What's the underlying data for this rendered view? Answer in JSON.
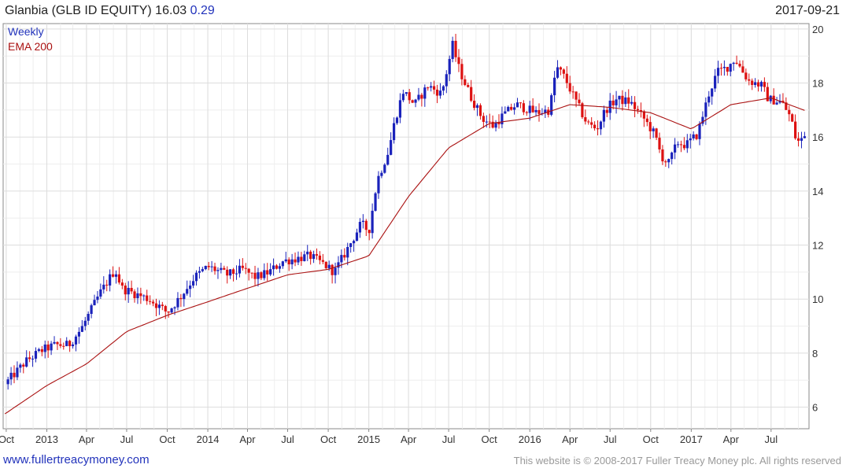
{
  "header": {
    "title": "Glanbia (GLB ID EQUITY) 16.03",
    "change": "0.29",
    "date": "2017-09-21"
  },
  "footer": {
    "site_link": "www.fullertreacymoney.com",
    "copyright": "This website is © 2008-2017 Fuller Treacy Money plc. All rights reserved"
  },
  "colors": {
    "up": "#1a22bb",
    "down": "#dd1111",
    "ema": "#aa1111",
    "grid": "#dddddd",
    "legend_weekly": "#2233bb",
    "legend_ema": "#aa1111"
  },
  "chart_data": {
    "type": "candlestick",
    "legend": [
      {
        "label": "Weekly",
        "color": "#2233bb"
      },
      {
        "label": "EMA 200",
        "color": "#aa1111"
      }
    ],
    "legend_position": "top-left",
    "y_axis": {
      "position": "right",
      "ylim": [
        5.2,
        20.2
      ],
      "ticks": [
        6,
        8,
        10,
        12,
        14,
        16,
        18,
        20
      ]
    },
    "x_axis": {
      "tick_labels": [
        "Oct",
        "2013",
        "Apr",
        "Jul",
        "Oct",
        "2014",
        "Apr",
        "Jul",
        "Oct",
        "2015",
        "Apr",
        "Jul",
        "Oct",
        "2016",
        "Apr",
        "Jul",
        "Oct",
        "2017",
        "Apr",
        "Jul"
      ],
      "tick_dates": [
        "2012-10-01",
        "2013-01-01",
        "2013-04-01",
        "2013-07-01",
        "2013-10-01",
        "2014-01-01",
        "2014-04-01",
        "2014-07-01",
        "2014-10-01",
        "2015-01-01",
        "2015-04-01",
        "2015-07-01",
        "2015-10-01",
        "2016-01-01",
        "2016-04-01",
        "2016-07-01",
        "2016-10-01",
        "2017-01-01",
        "2017-04-01",
        "2017-07-01"
      ],
      "range": [
        "2012-09-24",
        "2017-09-25"
      ]
    },
    "grid": true,
    "price_path": [
      [
        "2012-09-28",
        6.85
      ],
      [
        "2012-11-15",
        7.7
      ],
      [
        "2012-12-20",
        8.1
      ],
      [
        "2013-01-20",
        8.3
      ],
      [
        "2013-02-20",
        8.3
      ],
      [
        "2013-03-20",
        8.9
      ],
      [
        "2013-05-01",
        10.2
      ],
      [
        "2013-06-05",
        11.1
      ],
      [
        "2013-06-20",
        10.4
      ],
      [
        "2013-07-20",
        10.2
      ],
      [
        "2013-08-20",
        10.0
      ],
      [
        "2013-09-15",
        9.7
      ],
      [
        "2013-10-01",
        9.5
      ],
      [
        "2013-11-01",
        10.1
      ],
      [
        "2013-12-01",
        10.8
      ],
      [
        "2014-01-01",
        11.2
      ],
      [
        "2014-02-15",
        10.9
      ],
      [
        "2014-03-20",
        11.1
      ],
      [
        "2014-04-20",
        10.8
      ],
      [
        "2014-05-20",
        11.0
      ],
      [
        "2014-06-20",
        11.4
      ],
      [
        "2014-07-20",
        11.5
      ],
      [
        "2014-08-20",
        11.6
      ],
      [
        "2014-09-20",
        11.3
      ],
      [
        "2014-10-15",
        11.0
      ],
      [
        "2014-11-15",
        11.9
      ],
      [
        "2014-12-15",
        12.8
      ],
      [
        "2015-01-01",
        12.5
      ],
      [
        "2015-01-20",
        14.4
      ],
      [
        "2015-02-15",
        15.5
      ],
      [
        "2015-03-01",
        16.6
      ],
      [
        "2015-03-20",
        17.7
      ],
      [
        "2015-04-15",
        17.2
      ],
      [
        "2015-05-15",
        17.9
      ],
      [
        "2015-06-15",
        17.6
      ],
      [
        "2015-07-10",
        19.4
      ],
      [
        "2015-07-25",
        18.5
      ],
      [
        "2015-08-20",
        17.5
      ],
      [
        "2015-09-15",
        16.7
      ],
      [
        "2015-10-10",
        16.4
      ],
      [
        "2015-11-01",
        16.8
      ],
      [
        "2015-12-01",
        17.2
      ],
      [
        "2016-01-15",
        16.9
      ],
      [
        "2016-02-15",
        17.0
      ],
      [
        "2016-03-01",
        18.6
      ],
      [
        "2016-03-20",
        18.2
      ],
      [
        "2016-04-15",
        17.3
      ],
      [
        "2016-05-10",
        16.5
      ],
      [
        "2016-06-01",
        16.3
      ],
      [
        "2016-06-20",
        17.0
      ],
      [
        "2016-07-15",
        17.4
      ],
      [
        "2016-08-15",
        17.3
      ],
      [
        "2016-09-15",
        16.7
      ],
      [
        "2016-10-10",
        16.1
      ],
      [
        "2016-10-25",
        15.3
      ],
      [
        "2016-11-10",
        15.0
      ],
      [
        "2016-12-01",
        15.8
      ],
      [
        "2016-12-20",
        15.7
      ],
      [
        "2017-01-15",
        16.1
      ],
      [
        "2017-02-10",
        17.6
      ],
      [
        "2017-03-01",
        18.4
      ],
      [
        "2017-03-25",
        18.6
      ],
      [
        "2017-04-10",
        18.9
      ],
      [
        "2017-05-10",
        18.1
      ],
      [
        "2017-06-10",
        17.9
      ],
      [
        "2017-06-25",
        17.4
      ],
      [
        "2017-07-25",
        17.3
      ],
      [
        "2017-08-15",
        16.7
      ],
      [
        "2017-08-28",
        15.8
      ],
      [
        "2017-09-21",
        16.03
      ]
    ],
    "ema_200_path": [
      [
        "2012-09-28",
        5.75
      ],
      [
        "2013-01-01",
        6.8
      ],
      [
        "2013-04-01",
        7.6
      ],
      [
        "2013-07-01",
        8.8
      ],
      [
        "2013-10-01",
        9.4
      ],
      [
        "2014-01-01",
        9.9
      ],
      [
        "2014-04-01",
        10.4
      ],
      [
        "2014-07-01",
        10.9
      ],
      [
        "2014-10-01",
        11.1
      ],
      [
        "2015-01-01",
        11.6
      ],
      [
        "2015-04-01",
        13.8
      ],
      [
        "2015-07-01",
        15.6
      ],
      [
        "2015-10-01",
        16.5
      ],
      [
        "2016-01-01",
        16.7
      ],
      [
        "2016-04-01",
        17.2
      ],
      [
        "2016-07-01",
        17.1
      ],
      [
        "2016-10-01",
        16.9
      ],
      [
        "2017-01-01",
        16.3
      ],
      [
        "2017-04-01",
        17.2
      ],
      [
        "2017-07-01",
        17.45
      ],
      [
        "2017-09-21",
        16.95
      ]
    ],
    "candle_range_ticks": 0.35,
    "last_close": 16.03
  }
}
